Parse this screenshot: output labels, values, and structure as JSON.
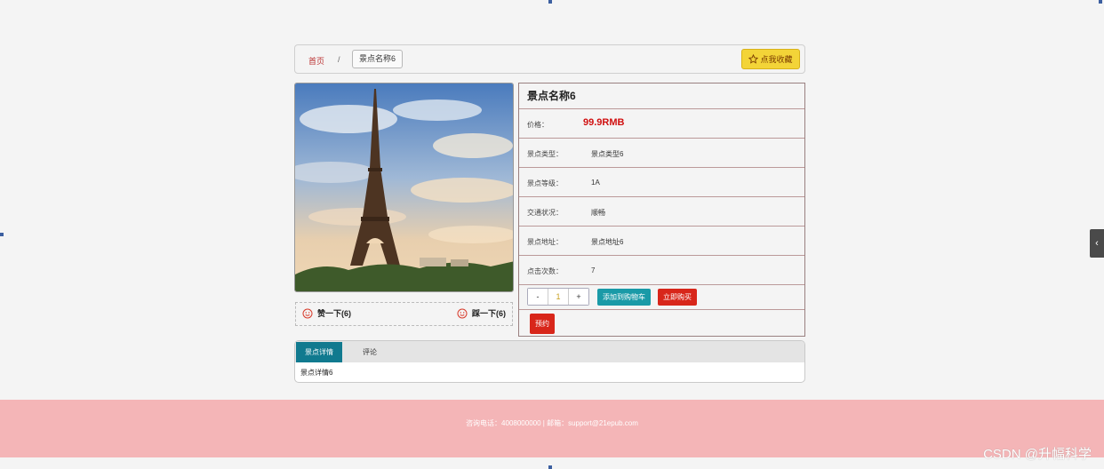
{
  "breadcrumb": {
    "home": "首页",
    "separator": "/",
    "current": "景点名称6"
  },
  "favorite": {
    "label": "点我收藏",
    "icon": "star-icon"
  },
  "attraction": {
    "title": "景点名称6",
    "price_label": "价格：",
    "price": "99.9RMB",
    "fields": [
      {
        "label": "景点类型：",
        "value": "景点类型6"
      },
      {
        "label": "景点等级：",
        "value": "1A"
      },
      {
        "label": "交通状况：",
        "value": "顺畅"
      },
      {
        "label": "景点地址：",
        "value": "景点地址6"
      },
      {
        "label": "点击次数：",
        "value": "7"
      }
    ]
  },
  "votes": {
    "up": "赞一下(6)",
    "down": "踩一下(6)",
    "icon": "smiley-icon"
  },
  "cart": {
    "minus": "-",
    "quantity": "1",
    "plus": "+",
    "add_to_cart": "添加到购物车",
    "buy_now": "立即购买",
    "book": "预约"
  },
  "tabs": {
    "active": "景点详情",
    "other": "评论",
    "content": "景点详情6"
  },
  "footer": {
    "text": "咨询电话：4008000000 | 邮箱：support@21epub.com"
  },
  "watermark": "CSDN @升幅科学",
  "colors": {
    "price": "#d01010",
    "tab_active": "#117a8f",
    "footer_bg": "#f4b5b7",
    "favorite_bg": "#f3d438",
    "buy_bg": "#d8261a",
    "cart_bg": "#1a9aa7"
  }
}
